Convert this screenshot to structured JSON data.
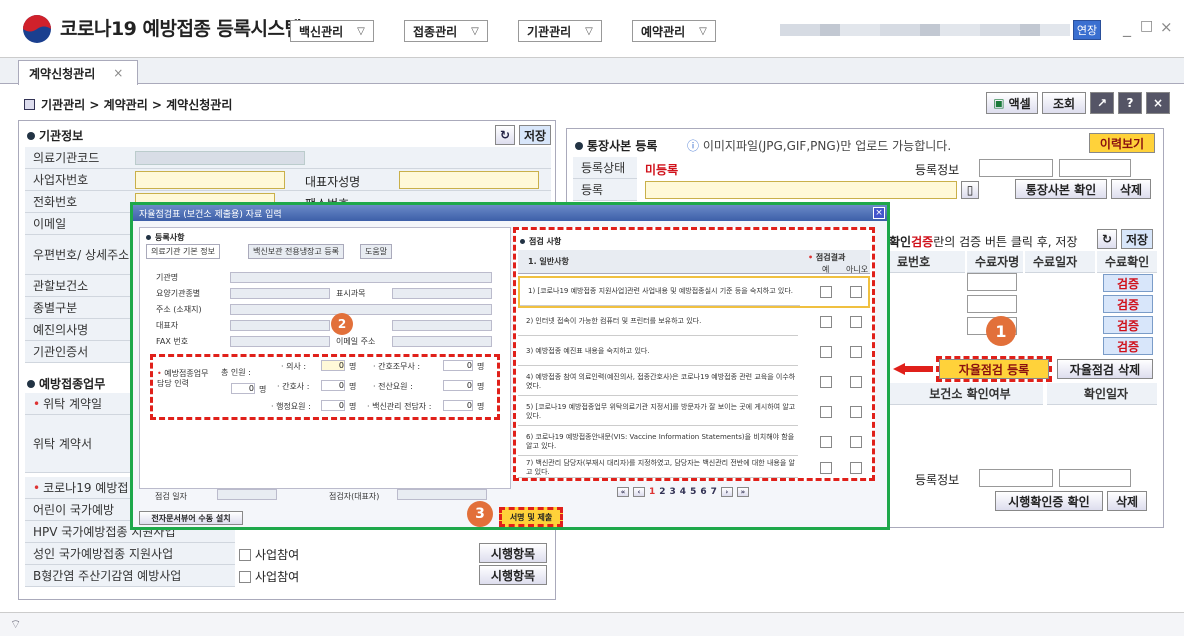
{
  "app": {
    "title": "코로나19 예방접종 등록시스템",
    "menus": [
      "백신관리",
      "접종관리",
      "기관관리",
      "예약관리"
    ],
    "extend_label": "연장",
    "window_controls": [
      "_",
      "□",
      "×"
    ]
  },
  "tabs": [
    {
      "label": "계약신청관리",
      "close": "×"
    }
  ],
  "breadcrumb": "기관관리 > 계약관리 > 계약신청관리",
  "toolbar": {
    "excel": "액셀",
    "search": "조회",
    "copy": "↗",
    "help": "?",
    "close": "×"
  },
  "org_info": {
    "title": "기관정보",
    "save": "저장",
    "refresh": "↻",
    "rows": [
      "의료기관코드",
      "사업자번호",
      "전화번호",
      "이메일",
      "우편번호/ 상세주소",
      "관할보건소",
      "종별구분",
      "예진의사명",
      "기관인증서"
    ],
    "rep_label": "대표자성명",
    "fax_label": "팩스번호"
  },
  "vaccine_section": {
    "title": "예방접종업무",
    "consign_date": "위탁 계약일",
    "consign_doc": "위탁 계약서",
    "covid_label": "코로나19 예방접",
    "child_label": "어린이 국가예방",
    "hpv_label": "HPV 국가예방접종 지원사업",
    "adult_label": "성인 국가예방접종 지원사업",
    "hepb_label": "B형간염 주산기감염 예방사업",
    "participate": "사업참여",
    "exec_item": "시행항목"
  },
  "bank": {
    "title": "통장사본 등록",
    "note": "이미지파일(JPG,GIF,PNG)만 업로드 가능합니다.",
    "history": "이력보기",
    "status_label": "등록상태",
    "status_value": "미등록",
    "reg_info": "등록정보",
    "register": "등록",
    "confirm": "통장사본 확인",
    "delete": "삭제"
  },
  "training": {
    "prefix": "확인",
    "red": "검증",
    "suffix": "란의 검증 버튼 클릭 후, 저장",
    "save": "저장",
    "refresh": "↻",
    "cols": [
      "료번호",
      "수료자명",
      "수료일자",
      "수료확인"
    ],
    "verify": "검증"
  },
  "self_check": {
    "register": "자율점검 등록",
    "delete": "자율점검 삭제",
    "cols": [
      "보건소 확인여부",
      "확인일자"
    ]
  },
  "lower": {
    "reg_info": "등록정보",
    "confirm": "시행확인증 확인",
    "delete": "삭제"
  },
  "dialog": {
    "title": "자율점검표 (보건소 제출용) 자료 입력",
    "close": "×",
    "reg_title": "등록사항",
    "tabs": [
      "의료기관 기본 정보",
      "백신보관 전용냉장고 등록",
      "도움말"
    ],
    "fields": [
      "기관명",
      "요양기관종별",
      "주소 (소재지)",
      "대표자",
      "FAX 번호"
    ],
    "fields_right": [
      "표시과목",
      "전화",
      "이메일 주소"
    ],
    "staff": {
      "label": "예방접종업무 담당 인력",
      "total": "총 인원 :",
      "doctor": "· 의사 :",
      "nurse_aide": "· 간호조무사 :",
      "nurse": "· 간호사 :",
      "it": "· 전산요원 :",
      "admin": "· 행정요원 :",
      "vaccine_mgr": "· 백신관리 전담자 :",
      "unit": "명",
      "zero": "0"
    },
    "check_date": "점검 일자",
    "checker": "점검자(대표자)",
    "install": "전자문서뷰어 수동 설치",
    "check_title": "점검 사항",
    "check_header": "1. 일반사항",
    "result": "점검결과",
    "yes": "예",
    "no": "아니오",
    "items": [
      "1) [코로나19 예방접종 지원사업]관련 사업내용 및 예방접종실시 기준 등을 숙지하고 있다.",
      "2) 인터넷 접속이 가능한 컴퓨터 및 프린터를 보유하고 있다.",
      "3) 예방접종 예진표 내용을 숙지하고 있다.",
      "4) 예방접종 참여 의료인력(예진의사, 접종간호사)은 코로나19 예방접종 관련 교육을 이수하였다.",
      "5) [코로나19 예방접종업무 위탁의료기관 지정서]를 방문자가 잘 보이는 곳에 게시하여 알고 있다.",
      "6) 코로나19 예방접종안내문(VIS: Vaccine Information Statements)을 비치해야 함을 알고 있다.",
      "7) 백신관리 담당자(부재시 대리자)를 지정하였고, 담당자는 백신관리 전반에 대한 내용을 알고 있다."
    ],
    "pages": [
      "1",
      "2",
      "3",
      "4",
      "5",
      "6",
      "7"
    ],
    "submit": "서명 및 제출"
  },
  "badges": [
    "1",
    "2",
    "3"
  ]
}
